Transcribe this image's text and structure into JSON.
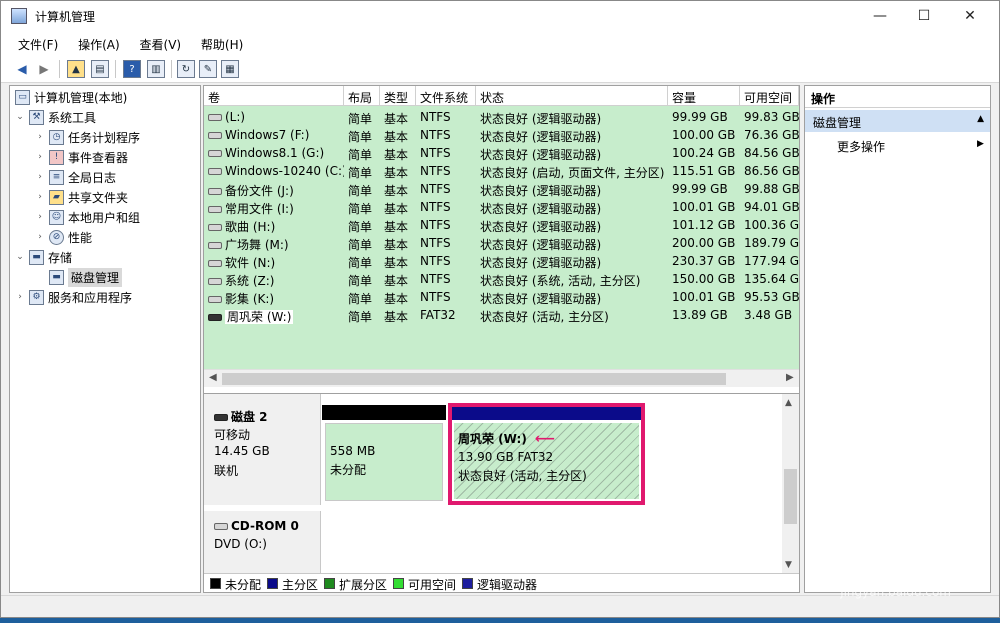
{
  "window": {
    "title": "计算机管理",
    "minimize": "—",
    "maximize": "☐",
    "close": "✕"
  },
  "menu": [
    "文件(F)",
    "操作(A)",
    "查看(V)",
    "帮助(H)"
  ],
  "tree": {
    "root": "计算机管理(本地)",
    "system_tools": "系统工具",
    "task_scheduler": "任务计划程序",
    "event_viewer": "事件查看器",
    "shared_folders": "共享文件夹",
    "local_users": "本地用户和组",
    "performance": "性能",
    "storage": "存储",
    "disk_management": "磁盘管理",
    "services_apps": "服务和应用程序",
    "root_global": "全局日志"
  },
  "volumes": {
    "columns": [
      "卷",
      "布局",
      "类型",
      "文件系统",
      "状态",
      "容量",
      "可用空间"
    ],
    "rows": [
      [
        "(L:)",
        "简单",
        "基本",
        "NTFS",
        "状态良好 (逻辑驱动器)",
        "99.99 GB",
        "99.83 GB"
      ],
      [
        "Windows7 (F:)",
        "简单",
        "基本",
        "NTFS",
        "状态良好 (逻辑驱动器)",
        "100.00 GB",
        "76.36 GB"
      ],
      [
        "Windows8.1 (G:)",
        "简单",
        "基本",
        "NTFS",
        "状态良好 (逻辑驱动器)",
        "100.24 GB",
        "84.56 GB"
      ],
      [
        "Windows-10240 (C:)",
        "简单",
        "基本",
        "NTFS",
        "状态良好 (启动, 页面文件, 主分区)",
        "115.51 GB",
        "86.56 GB"
      ],
      [
        "备份文件 (J:)",
        "简单",
        "基本",
        "NTFS",
        "状态良好 (逻辑驱动器)",
        "99.99 GB",
        "99.88 GB"
      ],
      [
        "常用文件 (I:)",
        "简单",
        "基本",
        "NTFS",
        "状态良好 (逻辑驱动器)",
        "100.01 GB",
        "94.01 GB"
      ],
      [
        "歌曲 (H:)",
        "简单",
        "基本",
        "NTFS",
        "状态良好 (逻辑驱动器)",
        "101.12 GB",
        "100.36 G"
      ],
      [
        "广场舞 (M:)",
        "简单",
        "基本",
        "NTFS",
        "状态良好 (逻辑驱动器)",
        "200.00 GB",
        "189.79 G"
      ],
      [
        "软件 (N:)",
        "简单",
        "基本",
        "NTFS",
        "状态良好 (逻辑驱动器)",
        "230.37 GB",
        "177.94 G"
      ],
      [
        "系统 (Z:)",
        "简单",
        "基本",
        "NTFS",
        "状态良好 (系统, 活动, 主分区)",
        "150.00 GB",
        "135.64 G"
      ],
      [
        "影集 (K:)",
        "简单",
        "基本",
        "NTFS",
        "状态良好 (逻辑驱动器)",
        "100.01 GB",
        "95.53 GB"
      ],
      [
        "周巩荣 (W:)",
        "简单",
        "基本",
        "FAT32",
        "状态良好 (活动, 主分区)",
        "13.89 GB",
        "3.48 GB"
      ]
    ]
  },
  "disk2": {
    "name": "磁盘 2",
    "type": "可移动",
    "size": "14.45 GB",
    "state": "联机",
    "unalloc_size": "558 MB",
    "unalloc_label": "未分配",
    "part_name": "周巩荣 (W:)",
    "part_size": "13.90 GB FAT32",
    "part_status": "状态良好 (活动, 主分区)"
  },
  "cdrom": {
    "name": "CD-ROM 0",
    "drive": "DVD (O:)"
  },
  "legend": [
    "未分配",
    "主分区",
    "扩展分区",
    "可用空间",
    "逻辑驱动器"
  ],
  "colors": {
    "unallocated": "#000000",
    "primary": "#0b0b8a",
    "extended": "#1f8a1f",
    "free": "#33dd33",
    "logical": "#1e1e9e",
    "highlight": "#e0196e"
  },
  "actions": {
    "header": "操作",
    "selected": "磁盘管理",
    "more": "更多操作"
  },
  "watermark": {
    "brand": "Bai 经验",
    "url": "jingyan.baidu.com"
  }
}
